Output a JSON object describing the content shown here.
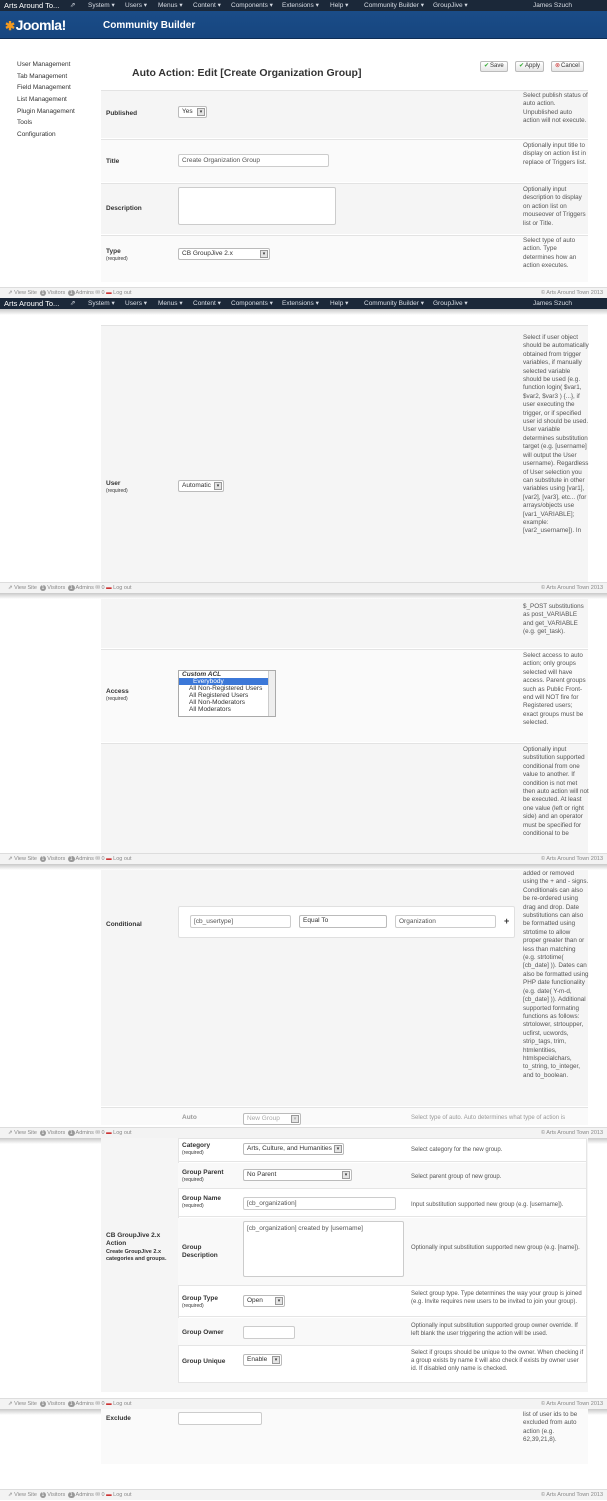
{
  "navbar": {
    "site": "Arts Around To...",
    "menu": [
      "System ▾",
      "Users ▾",
      "Menus ▾",
      "Content ▾",
      "Components ▾",
      "Extensions ▾",
      "Help ▾",
      "Community Builder ▾",
      "GroupJive ▾"
    ],
    "user": "James Szuch"
  },
  "header": {
    "logo": "Joomla!",
    "title": "Community Builder"
  },
  "footer": {
    "view_site": "View Site",
    "visitors_count": "1",
    "visitors": "Visitors",
    "admins_count": "1",
    "admins": "Admins",
    "messages": "0",
    "logout": "Log out",
    "copyright": "© Arts Around Town 2013"
  },
  "sidebar": [
    "User Management",
    "Tab Management",
    "Field Management",
    "List Management",
    "Plugin Management",
    "Tools",
    "Configuration"
  ],
  "page": {
    "title": "Auto Action:",
    "title_edit": "Edit [Create Organization Group]"
  },
  "toolbar": {
    "save": "Save",
    "apply": "Apply",
    "cancel": "Cancel"
  },
  "fields": {
    "published": {
      "label": "Published",
      "value": "Yes",
      "help": "Select publish status of auto action. Unpublished auto action will not execute."
    },
    "title": {
      "label": "Title",
      "value": "Create Organization Group",
      "help": "Optionally input title to display on action list in replace of Triggers list."
    },
    "description": {
      "label": "Description",
      "help": "Optionally input description to display on action list on mouseover of Triggers list or Title."
    },
    "type": {
      "label": "Type",
      "req": "(required)",
      "value": "CB GroupJive 2.x",
      "help": "Select type of auto action. Type determines how an action executes."
    },
    "user": {
      "label": "User",
      "req": "(required)",
      "value": "Automatic",
      "help": "Select if user object should be automatically obtained from trigger variables, if manually selected variable should be used (e.g. function login( $var1, $var2, $var3 ) {...}, if user executing the trigger, or if specified user id should be used. User variable determines substitution target (e.g. [username] will output the User username). Regardless of User selection you can substitute in other variables using [var1], [var2], [var3], etc... (for arrays/objects use [var1_VARIABLE]; example: [var2_username]). In"
    },
    "user_help_cont": "$_POST substitutions as post_VARIABLE and get_VARIABLE (e.g. get_task).",
    "access": {
      "label": "Access",
      "req": "(required)",
      "options": [
        "Custom ACL",
        "Everybody",
        "All Non-Registered Users",
        "All Registered Users",
        "All Non-Moderators",
        "All Moderators"
      ],
      "help": "Select access to auto action; only groups selected will have access. Parent groups such as Public Front-end will NOT fire for Registered users; exact groups must be selected."
    },
    "conditional_help_top": "Optionally input substitution supported conditional from one value to another. If condition is not met then auto action will not be executed. At least one value (left or right side) and an operator must be specified for conditional to be",
    "conditional": {
      "label": "Conditional",
      "left": "[cb_usertype]",
      "op": "Equal To",
      "right": "Organization",
      "add": "+",
      "help": "added or removed using the + and - signs. Conditionals can also be re-ordered using drag and drop. Date substitutions can also be formatted using strtotime to allow proper greater than or less than matching (e.g. strtotime( [cb_date] )). Dates can also be formatted using PHP date functionality (e.g. date( Y-m-d, [cb_date] )). Additional supported formating functions as follows: strtolower, strtoupper, ucfirst, ucwords, strip_tags, trim, htmlentities, htmlspecialchars, to_string, to_integer, and to_boolean."
    },
    "auto": {
      "label": "Auto",
      "value": "New Group",
      "help": "Select type of auto. Auto determines what type of action is"
    },
    "cbgj": {
      "label": "CB GroupJive 2.x Action",
      "desc": "Create GroupJive 2.x categories and groups."
    },
    "category": {
      "label": "Category",
      "req": "(required)",
      "value": "Arts, Culture, and Humanities",
      "help": "Select category for the new group."
    },
    "group_parent": {
      "label": "Group Parent",
      "req": "(required)",
      "value": "No Parent",
      "help": "Select parent group of new group."
    },
    "group_name": {
      "label": "Group Name",
      "req": "(required)",
      "value": "[cb_organization]",
      "help": "Input substitution supported new group (e.g. [username])."
    },
    "group_description": {
      "label": "Group Description",
      "value": "[cb_organization] created by [username]",
      "help": "Optionally input substitution supported new group (e.g. [name])."
    },
    "group_type": {
      "label": "Group Type",
      "req": "(required)",
      "value": "Open",
      "help": "Select group type. Type determines the way your group is joined (e.g. Invite requires new users to be invited to join your group)."
    },
    "group_owner": {
      "label": "Group Owner",
      "help": "Optionally input substitution supported group owner override. If left blank the user triggering the action will be used."
    },
    "group_unique": {
      "label": "Group Unique",
      "value": "Enable",
      "help": "Select if groups should be unique to the owner. When checking if a group exists by name it will also check if exists by owner user id. If disabled only name is checked."
    },
    "exclude": {
      "label": "Exclude",
      "help": "list of user ids to be excluded from auto action (e.g. 62,39,21,8)."
    }
  }
}
